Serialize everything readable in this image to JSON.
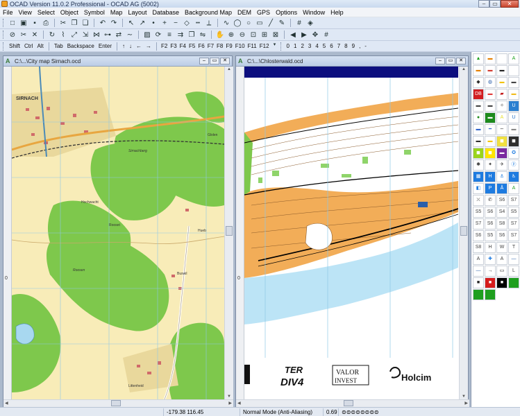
{
  "window": {
    "title": "OCAD Version 11.0.2  Professional - OCAD AG (5002)",
    "min_glyph": "–",
    "max_glyph": "▭",
    "close_glyph": "✕"
  },
  "menu": [
    "File",
    "View",
    "Select",
    "Object",
    "Symbol",
    "Map",
    "Layout",
    "Database",
    "Background Map",
    "DEM",
    "GPS",
    "Options",
    "Window",
    "Help"
  ],
  "toolbar1": {
    "icons": [
      "new-file-icon",
      "open-folder-icon",
      "save-icon",
      "print-icon",
      "cut-icon",
      "copy-icon",
      "paste-icon",
      "undo-icon",
      "redo-icon",
      "pointer-icon",
      "edit-object-icon",
      "edit-point-icon",
      "add-point-icon",
      "remove-point-icon",
      "corner-point-icon",
      "dash-point-icon",
      "measure-icon",
      "curve-mode-icon",
      "ellipse-mode-icon",
      "circle-mode-icon",
      "rectangle-mode-icon",
      "straight-line-icon",
      "freehand-icon",
      "numeric-icon",
      "graphics-icon"
    ],
    "glyphs": [
      "□",
      "▣",
      "▪",
      "⎙",
      "✂",
      "❐",
      "❏",
      "↶",
      "↷",
      "↖",
      "↗",
      "•",
      "+",
      "−",
      "◇",
      "┅",
      "⟂",
      "∿",
      "◯",
      "○",
      "▭",
      "╱",
      "✎",
      "#",
      "◈"
    ]
  },
  "toolbar2": {
    "icons": [
      "cut-hole-icon",
      "cut-object-icon",
      "delete-icon",
      "rotate-icon",
      "reshape-icon",
      "stretch-icon",
      "scale-icon",
      "merge-icon",
      "join-icon",
      "reverse-icon",
      "smooth-icon",
      "fill-icon",
      "convert-icon",
      "align-icon",
      "move-parallel-icon",
      "duplicate-icon",
      "mirror-icon",
      "hand-icon",
      "zoom-in-icon",
      "zoom-out-icon",
      "zoom-fit-icon",
      "zoom-selection-icon",
      "zoom-window-icon",
      "previous-view-icon",
      "next-view-icon",
      "move-icon",
      "grid-icon"
    ],
    "glyphs": [
      "⊘",
      "✂",
      "✕",
      "↻",
      "⌇",
      "⤢",
      "⇲",
      "⋈",
      "⊶",
      "⇄",
      "∼",
      "▨",
      "⟳",
      "≡",
      "⇉",
      "❐",
      "⇋",
      "✋",
      "⊕",
      "⊖",
      "⊡",
      "⊞",
      "⊠",
      "◀",
      "▶",
      "✥",
      "#"
    ]
  },
  "toolbar3": {
    "keys": [
      "Shift",
      "Ctrl",
      "Alt",
      "Tab",
      "Backspace",
      "Enter"
    ],
    "arrows": [
      "↑",
      "↓",
      "←",
      "→"
    ],
    "fkeys": [
      "F2",
      "F3",
      "F4",
      "F5",
      "F6",
      "F7",
      "F8",
      "F9",
      "F10",
      "F11",
      "F12"
    ],
    "digits": [
      "0",
      "1",
      "2",
      "3",
      "4",
      "5",
      "6",
      "7",
      "8",
      "9",
      ",",
      "-"
    ]
  },
  "doc1": {
    "title": "C:\\...\\City map Sirnach.ocd",
    "ruler_label": "0",
    "labels": {
      "town": "SIRNACH",
      "glolen": "Glolen",
      "hochwacht": "Hochwacht",
      "sirnachberg": "Sirnachberg",
      "rooset": "Rooset",
      "hueb": "Hueb",
      "buswil": "Buswil",
      "roosen": "Roosen",
      "littenheid": "Littenheid"
    }
  },
  "doc2": {
    "title": "C:\\...\\Chlosterwald.ocd",
    "ruler_label": "0",
    "sponsors": {
      "terdiv_top": "TER",
      "terdiv_bottom": "DIV4",
      "valor_top": "VALOR",
      "valor_bottom": "INVEST",
      "holcim": "Holcim"
    }
  },
  "symbols": {
    "glyphs": [
      "▲",
      "▬",
      "✚",
      "A",
      "▬",
      "▬",
      "▬",
      "▭",
      "◆",
      "◍",
      "▬",
      "▬",
      "DB",
      "▬",
      "▰",
      "▬",
      "▬",
      "▬",
      "✧",
      "U",
      "●",
      "▬",
      "A",
      "U",
      "▬",
      "━",
      "┅",
      "▬",
      "▬",
      "▬",
      "◼",
      "◼",
      "◼",
      "◼",
      "▬",
      "✪",
      "✱",
      "✦",
      "✈",
      "ⓟ",
      "▦",
      "H",
      "⚓",
      "♿",
      "◧",
      "P",
      "Å",
      "A",
      "⛌",
      "✆",
      "S6",
      "S7",
      "S5",
      "S6",
      "S4",
      "S5",
      "S7",
      "S6",
      "S8",
      "S7",
      "S6",
      "S5",
      "S6",
      "S7",
      "S8",
      "H",
      "W",
      "T",
      "A",
      "✚",
      "A",
      "—",
      "—",
      "→",
      "▭",
      "L",
      "■",
      "■",
      "■",
      "",
      "",
      ""
    ],
    "colors": [
      "#1ba01b",
      "#e57f00",
      "#fff",
      "#1ba01b",
      "#e57f00",
      "#d23a2f",
      "#222",
      "#fff",
      "#2c2c2c",
      "#2b5faa",
      "#f2c200",
      "#444",
      "#d21d20",
      "#e03b3b",
      "#c21818",
      "#f1bc1b",
      "#444",
      "#444",
      "#444",
      "#2b7fd0",
      "#1d8b1d",
      "#1d8b1d",
      "#e8e030",
      "#1f6fc8",
      "#3366cc",
      "#3366cc",
      "#666",
      "#888",
      "#2f2f2f",
      "#f3c400",
      "#f0e040",
      "#2e2e2e",
      "#9ad41c",
      "#ffe400",
      "#7a2aa0",
      "#1e7be0",
      "#333",
      "#333",
      "#444",
      "#1e7be0",
      "#1e7be0",
      "#1e7be0",
      "#1e7be0",
      "#1e7be0",
      "#1e7be0",
      "#1e7be0",
      "#1e7be0",
      "#2aa02a",
      "#444",
      "#444",
      "#444",
      "#444",
      "#444",
      "#444",
      "#444",
      "#444",
      "#444",
      "#444",
      "#444",
      "#444",
      "#444",
      "#444",
      "#444",
      "#444",
      "#444",
      "#444",
      "#444",
      "#444",
      "#444",
      "#1e7be0",
      "#444",
      "#2b5faa",
      "#2b5faa",
      "#222",
      "#222",
      "#444",
      "#222",
      "#d61d1d",
      "#000",
      "#1f9f1f",
      "#1f9f1f",
      "#1f9f1f"
    ],
    "fills": [
      "#fff",
      "#fff",
      "#fff",
      "#fff",
      "#fff",
      "#fff",
      "#fff",
      "#fff",
      "#fff",
      "#fff",
      "#fff",
      "#fff",
      "#d21d20",
      "#fff",
      "#fff",
      "#fff",
      "#fff",
      "#fff",
      "#fff",
      "#2b7fd0",
      "#fff",
      "#1d8b1d",
      "#fff",
      "#fff",
      "#fff",
      "#fff",
      "#fff",
      "#fff",
      "#fff",
      "#fff",
      "#f0e040",
      "#2e2e2e",
      "#9ad41c",
      "#ffe400",
      "#7a2aa0",
      "#fff",
      "#fff",
      "#fff",
      "#fff",
      "#fff",
      "#1e7be0",
      "#1e7be0",
      "#fff",
      "#1e7be0",
      "#fff",
      "#1e7be0",
      "#1e7be0",
      "#fff",
      "#fff",
      "#fff",
      "#fff",
      "#fff",
      "#fff",
      "#fff",
      "#fff",
      "#fff",
      "#fff",
      "#fff",
      "#fff",
      "#fff",
      "#fff",
      "#fff",
      "#fff",
      "#fff",
      "#fff",
      "#fff",
      "#fff",
      "#fff",
      "#fff",
      "#fff",
      "#fff",
      "#fff",
      "#fff",
      "#fff",
      "#fff",
      "#fff",
      "#fff",
      "#d61d1d",
      "#000",
      "#1f9f1f",
      "#1f9f1f",
      "#1f9f1f"
    ]
  },
  "status": {
    "coords": "-179.38   116.45",
    "mode": "Normal Mode (Anti-Aliasing)",
    "zoom": "0.69"
  },
  "colors": {
    "map_beige": "#f8ecb8",
    "forest_green": "#7ec84c",
    "orienteering_orange": "#f2ad58",
    "water_blue": "#bce4f6",
    "grid_blue": "#8ec8e6"
  }
}
